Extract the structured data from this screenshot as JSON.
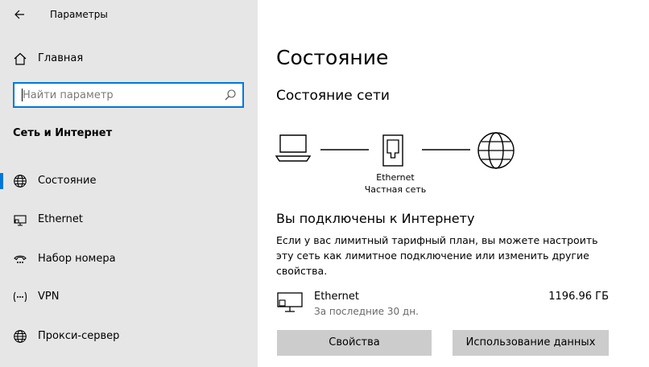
{
  "window": {
    "title": "Параметры"
  },
  "sidebar": {
    "home_label": "Главная",
    "search_placeholder": "Найти параметр",
    "section_title": "Сеть и Интернет",
    "items": [
      {
        "label": "Состояние",
        "icon": "globe-icon",
        "active": true
      },
      {
        "label": "Ethernet",
        "icon": "ethernet-icon",
        "active": false
      },
      {
        "label": "Набор номера",
        "icon": "dial-up-icon",
        "active": false
      },
      {
        "label": "VPN",
        "icon": "vpn-icon",
        "active": false
      },
      {
        "label": "Прокси-сервер",
        "icon": "globe-icon",
        "active": false
      }
    ]
  },
  "main": {
    "title": "Состояние",
    "subtitle": "Состояние сети",
    "diagram": {
      "adapter_name": "Ethernet",
      "network_type": "Частная сеть"
    },
    "connected_title": "Вы подключены к Интернету",
    "description": "Если у вас лимитный тарифный план, вы можете настроить эту сеть как лимитное подключение или изменить другие свойства.",
    "connection": {
      "name": "Ethernet",
      "period": "За последние 30 дн.",
      "usage": "1196.96 ГБ"
    },
    "buttons": {
      "properties": "Свойства",
      "data_usage": "Использование данных"
    }
  },
  "colors": {
    "accent": "#0078d7",
    "sidebar_bg": "#e6e6e6",
    "button_bg": "#cccccc"
  }
}
